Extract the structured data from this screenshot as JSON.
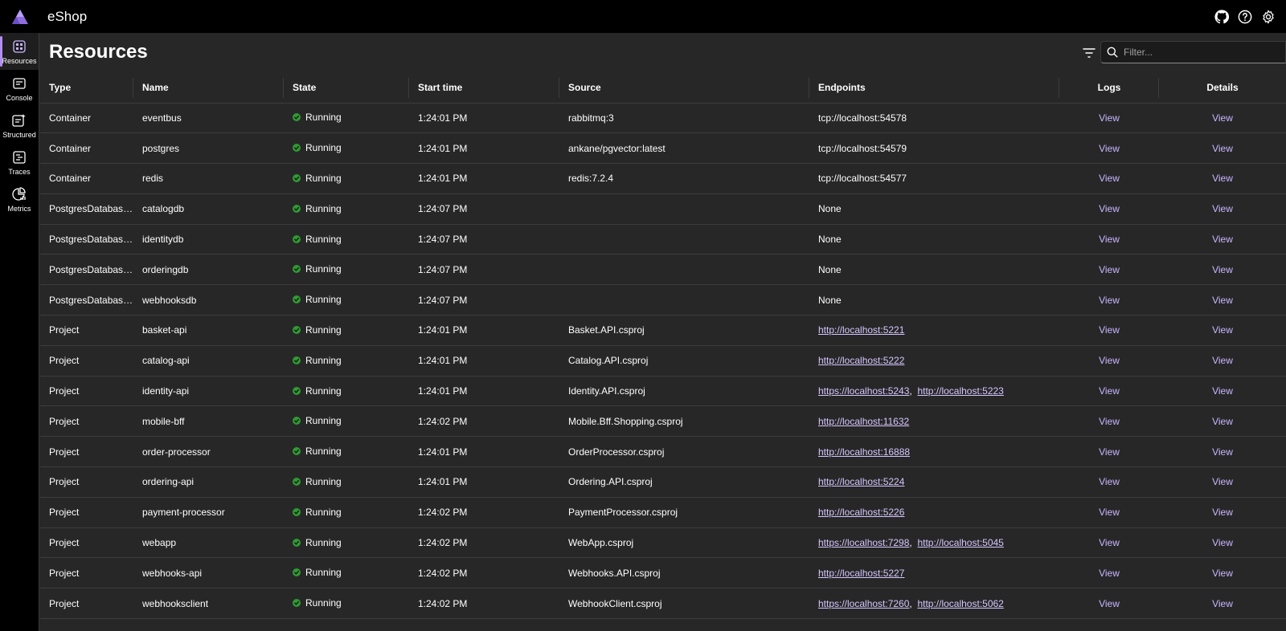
{
  "app": {
    "title": "eShop"
  },
  "colors": {
    "accent": "#b48df2",
    "running": "#2f9a33",
    "link": "#d6c7ff",
    "background": "#272727",
    "chrome": "#000000"
  },
  "top_actions": [
    {
      "icon": "github-icon"
    },
    {
      "icon": "help-icon"
    },
    {
      "icon": "settings-icon"
    }
  ],
  "sidebar": {
    "items": [
      {
        "label": "Resources",
        "icon": "resources-icon",
        "active": true
      },
      {
        "label": "Console",
        "icon": "console-icon",
        "active": false
      },
      {
        "label": "Structured",
        "icon": "structured-icon",
        "active": false
      },
      {
        "label": "Traces",
        "icon": "traces-icon",
        "active": false
      },
      {
        "label": "Metrics",
        "icon": "metrics-icon",
        "active": false
      }
    ]
  },
  "page": {
    "title": "Resources"
  },
  "search": {
    "placeholder": "Filter...",
    "value": ""
  },
  "table": {
    "headers": [
      "Type",
      "Name",
      "State",
      "Start time",
      "Source",
      "Endpoints",
      "Logs",
      "Details"
    ],
    "rows": [
      {
        "type": "Container",
        "name": "eventbus",
        "state": "Running",
        "start": "1:24:01 PM",
        "source": "rabbitmq:3",
        "endpoints": [
          {
            "text": "tcp://localhost:54578",
            "link": false
          }
        ],
        "logs": "View",
        "details": "View"
      },
      {
        "type": "Container",
        "name": "postgres",
        "state": "Running",
        "start": "1:24:01 PM",
        "source": "ankane/pgvector:latest",
        "endpoints": [
          {
            "text": "tcp://localhost:54579",
            "link": false
          }
        ],
        "logs": "View",
        "details": "View"
      },
      {
        "type": "Container",
        "name": "redis",
        "state": "Running",
        "start": "1:24:01 PM",
        "source": "redis:7.2.4",
        "endpoints": [
          {
            "text": "tcp://localhost:54577",
            "link": false
          }
        ],
        "logs": "View",
        "details": "View"
      },
      {
        "type": "PostgresDatabase...",
        "name": "catalogdb",
        "state": "Running",
        "start": "1:24:07 PM",
        "source": "",
        "endpoints": [
          {
            "text": "None",
            "link": false
          }
        ],
        "logs": "View",
        "details": "View"
      },
      {
        "type": "PostgresDatabase...",
        "name": "identitydb",
        "state": "Running",
        "start": "1:24:07 PM",
        "source": "",
        "endpoints": [
          {
            "text": "None",
            "link": false
          }
        ],
        "logs": "View",
        "details": "View"
      },
      {
        "type": "PostgresDatabase...",
        "name": "orderingdb",
        "state": "Running",
        "start": "1:24:07 PM",
        "source": "",
        "endpoints": [
          {
            "text": "None",
            "link": false
          }
        ],
        "logs": "View",
        "details": "View"
      },
      {
        "type": "PostgresDatabase...",
        "name": "webhooksdb",
        "state": "Running",
        "start": "1:24:07 PM",
        "source": "",
        "endpoints": [
          {
            "text": "None",
            "link": false
          }
        ],
        "logs": "View",
        "details": "View"
      },
      {
        "type": "Project",
        "name": "basket-api",
        "state": "Running",
        "start": "1:24:01 PM",
        "source": "Basket.API.csproj",
        "endpoints": [
          {
            "text": "http://localhost:5221",
            "link": true
          }
        ],
        "logs": "View",
        "details": "View"
      },
      {
        "type": "Project",
        "name": "catalog-api",
        "state": "Running",
        "start": "1:24:01 PM",
        "source": "Catalog.API.csproj",
        "endpoints": [
          {
            "text": "http://localhost:5222",
            "link": true
          }
        ],
        "logs": "View",
        "details": "View"
      },
      {
        "type": "Project",
        "name": "identity-api",
        "state": "Running",
        "start": "1:24:01 PM",
        "source": "Identity.API.csproj",
        "endpoints": [
          {
            "text": "https://localhost:5243",
            "link": true
          },
          {
            "text": "http://localhost:5223",
            "link": true
          }
        ],
        "logs": "View",
        "details": "View"
      },
      {
        "type": "Project",
        "name": "mobile-bff",
        "state": "Running",
        "start": "1:24:02 PM",
        "source": "Mobile.Bff.Shopping.csproj",
        "endpoints": [
          {
            "text": "http://localhost:11632",
            "link": true
          }
        ],
        "logs": "View",
        "details": "View"
      },
      {
        "type": "Project",
        "name": "order-processor",
        "state": "Running",
        "start": "1:24:01 PM",
        "source": "OrderProcessor.csproj",
        "endpoints": [
          {
            "text": "http://localhost:16888",
            "link": true
          }
        ],
        "logs": "View",
        "details": "View"
      },
      {
        "type": "Project",
        "name": "ordering-api",
        "state": "Running",
        "start": "1:24:01 PM",
        "source": "Ordering.API.csproj",
        "endpoints": [
          {
            "text": "http://localhost:5224",
            "link": true
          }
        ],
        "logs": "View",
        "details": "View"
      },
      {
        "type": "Project",
        "name": "payment-processor",
        "state": "Running",
        "start": "1:24:02 PM",
        "source": "PaymentProcessor.csproj",
        "endpoints": [
          {
            "text": "http://localhost:5226",
            "link": true
          }
        ],
        "logs": "View",
        "details": "View"
      },
      {
        "type": "Project",
        "name": "webapp",
        "state": "Running",
        "start": "1:24:02 PM",
        "source": "WebApp.csproj",
        "endpoints": [
          {
            "text": "https://localhost:7298",
            "link": true
          },
          {
            "text": "http://localhost:5045",
            "link": true
          }
        ],
        "logs": "View",
        "details": "View"
      },
      {
        "type": "Project",
        "name": "webhooks-api",
        "state": "Running",
        "start": "1:24:02 PM",
        "source": "Webhooks.API.csproj",
        "endpoints": [
          {
            "text": "http://localhost:5227",
            "link": true
          }
        ],
        "logs": "View",
        "details": "View"
      },
      {
        "type": "Project",
        "name": "webhooksclient",
        "state": "Running",
        "start": "1:24:02 PM",
        "source": "WebhookClient.csproj",
        "endpoints": [
          {
            "text": "https://localhost:7260",
            "link": true
          },
          {
            "text": "http://localhost:5062",
            "link": true
          }
        ],
        "logs": "View",
        "details": "View"
      }
    ]
  }
}
